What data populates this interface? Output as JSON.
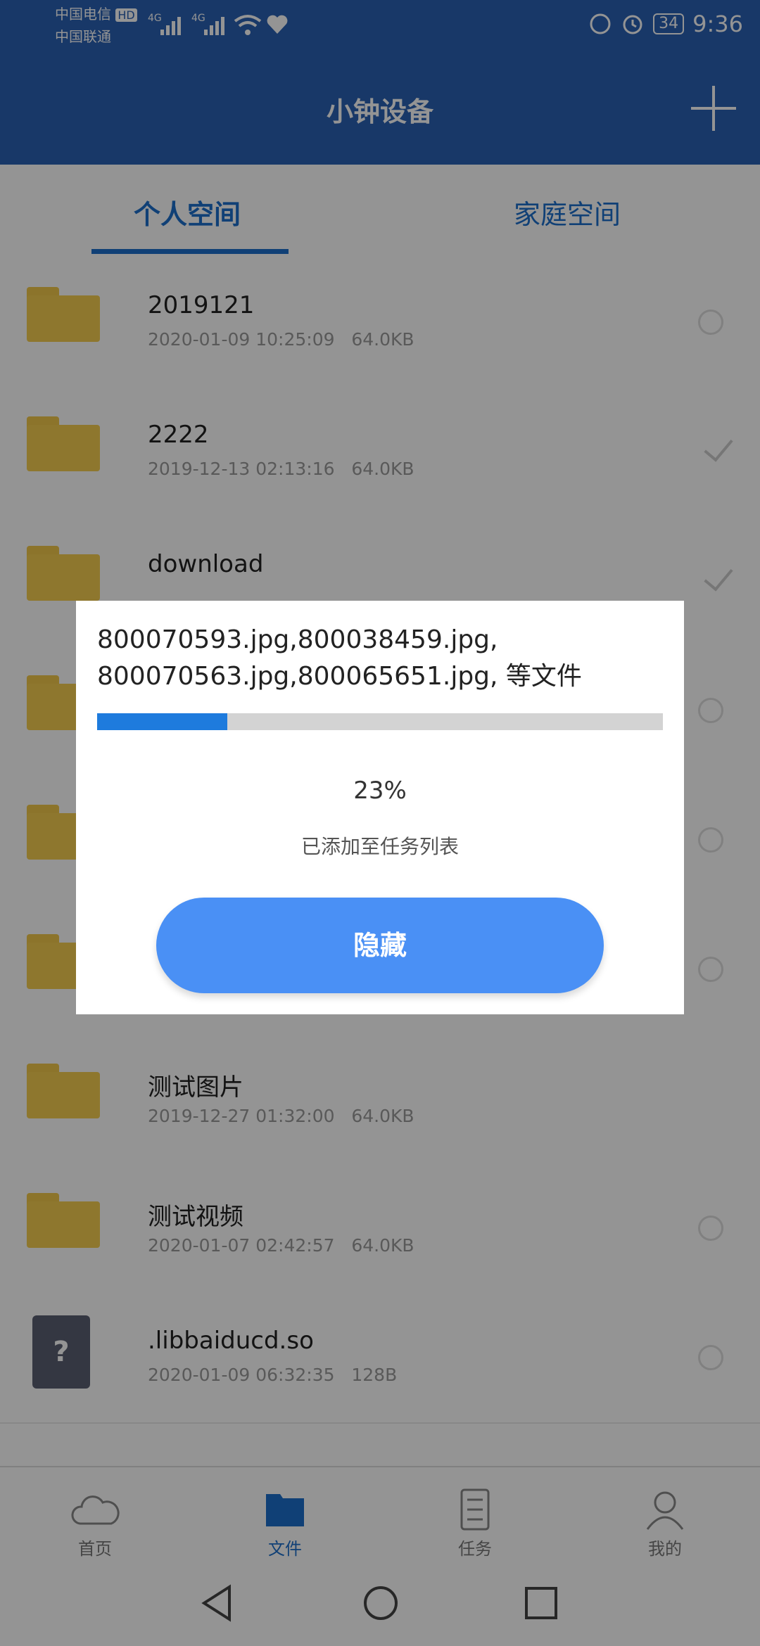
{
  "status_bar": {
    "carrier1": "中国电信",
    "carrier1_badge": "HD",
    "signal1": "4G",
    "carrier2": "中国联通",
    "signal2": "4G",
    "battery": "34",
    "time": "9:36"
  },
  "header": {
    "title": "小钟设备"
  },
  "tabs": [
    {
      "label": "个人空间",
      "active": true
    },
    {
      "label": "家庭空间",
      "active": false
    }
  ],
  "files": [
    {
      "type": "folder",
      "name": "2019121",
      "date": "2020-01-09 10:25:09",
      "size": "64.0KB"
    },
    {
      "type": "folder",
      "name": "2222",
      "date": "2019-12-13 02:13:16",
      "size": "64.0KB"
    },
    {
      "type": "folder",
      "name": "download",
      "date": "",
      "size": ""
    },
    {
      "type": "folder",
      "name": "",
      "date": "",
      "size": ""
    },
    {
      "type": "folder",
      "name": "",
      "date": "",
      "size": ""
    },
    {
      "type": "folder",
      "name": "",
      "date": "",
      "size": ""
    },
    {
      "type": "folder",
      "name": "测试图片",
      "date": "2019-12-27 01:32:00",
      "size": "64.0KB"
    },
    {
      "type": "folder",
      "name": "测试视频",
      "date": "2020-01-07 02:42:57",
      "size": "64.0KB"
    },
    {
      "type": "file",
      "icon": "?",
      "name": ".libbaiducd.so",
      "date": "2020-01-09 06:32:35",
      "size": "128B"
    }
  ],
  "bottom_nav": [
    {
      "label": "首页",
      "icon": "cloud-icon"
    },
    {
      "label": "文件",
      "icon": "folder-icon",
      "active": true
    },
    {
      "label": "任务",
      "icon": "task-list-icon"
    },
    {
      "label": "我的",
      "icon": "user-icon"
    }
  ],
  "dialog": {
    "files_line1": "800070593.jpg,800038459.jpg,",
    "files_line2": "800070563.jpg,800065651.jpg, 等文件",
    "progress": 0.23,
    "percent_label": "23%",
    "subtitle": "已添加至任务列表",
    "hide_label": "隐藏"
  },
  "colors": {
    "primary": "#2a61b3",
    "accent": "#1d6fcb",
    "button": "#4a90f5",
    "folder": "#f4ce50"
  }
}
